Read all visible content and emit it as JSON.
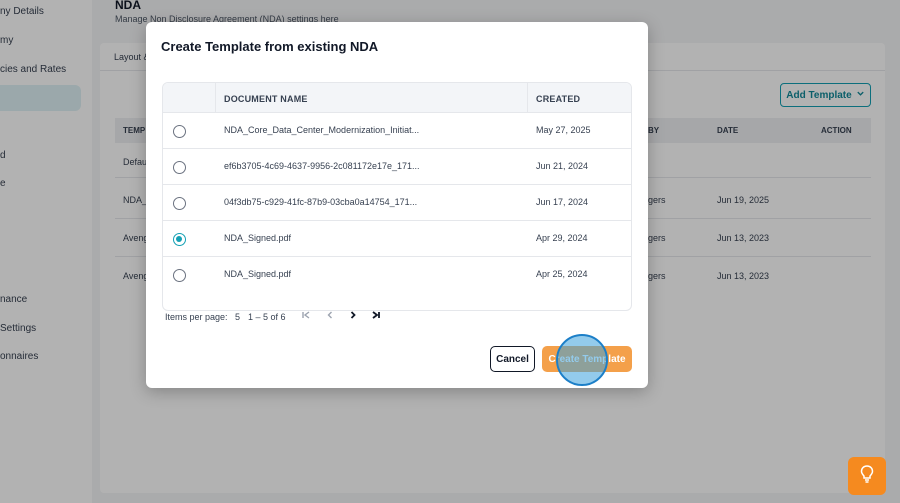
{
  "sidebar": {
    "items": [
      {
        "label": "ny Details"
      },
      {
        "label": "my"
      },
      {
        "label": "cies and Rates"
      },
      {
        "label": ""
      },
      {
        "label": "d"
      },
      {
        "label": "e"
      },
      {
        "label": "nance"
      },
      {
        "label": " Settings"
      },
      {
        "label": "onnaires"
      }
    ]
  },
  "page": {
    "title": "NDA",
    "subtitle": "Manage Non Disclosure Agreement (NDA) settings here",
    "tab": "Layout &",
    "add_template_label": "Add Template",
    "bg_table": {
      "headers": [
        "TEMP",
        "BY",
        "DATE",
        "ACTION"
      ],
      "rows": [
        {
          "name": "Defau",
          "by": "",
          "date": ""
        },
        {
          "name": "NDA_",
          "by": "gers",
          "date": "Jun 19, 2025"
        },
        {
          "name": "Aveng",
          "by": "gers",
          "date": "Jun 13, 2023"
        },
        {
          "name": "Aveng",
          "by": "gers",
          "date": "Jun 13, 2023"
        }
      ]
    }
  },
  "modal": {
    "title": "Create Template from existing NDA",
    "columns": {
      "name": "DOCUMENT NAME",
      "created": "CREATED"
    },
    "rows": [
      {
        "name": "NDA_Core_Data_Center_Modernization_Initiat...",
        "created": "May 27, 2025",
        "selected": false
      },
      {
        "name": "ef6b3705-4c69-4637-9956-2c081172e17e_171...",
        "created": "Jun 21, 2024",
        "selected": false
      },
      {
        "name": "04f3db75-c929-41fc-87b9-03cba0a14754_171...",
        "created": "Jun 17, 2024",
        "selected": false
      },
      {
        "name": "NDA_Signed.pdf",
        "created": "Apr 29, 2024",
        "selected": true
      },
      {
        "name": "NDA_Signed.pdf",
        "created": "Apr 25, 2024",
        "selected": false
      }
    ],
    "pagination": {
      "items_per_page_label": "Items per page:",
      "items_per_page": "5",
      "range": "1 – 5 of 6"
    },
    "cancel_label": "Cancel",
    "create_label": "Create Template"
  },
  "help": {
    "icon": "lightbulb-icon"
  },
  "colors": {
    "accent": "#14a0b4",
    "primary_button": "#f4a04a",
    "help_button": "#f58a1f"
  }
}
